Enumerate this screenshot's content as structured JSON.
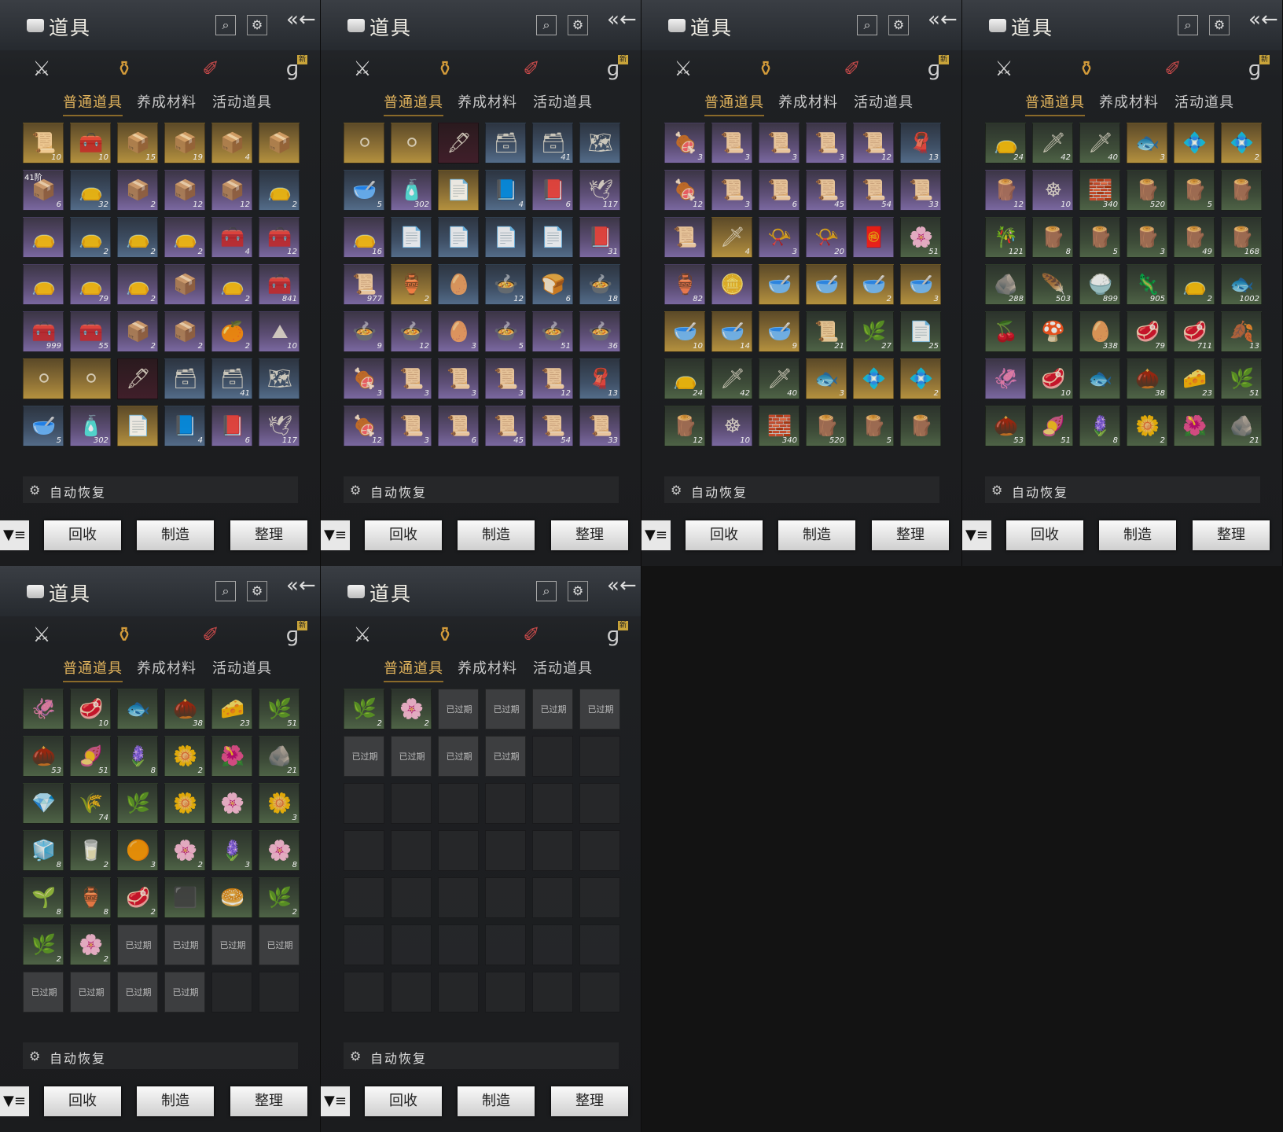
{
  "ui": {
    "title": "道具",
    "categories": [
      {
        "name": "weapon",
        "glyph": "⚔"
      },
      {
        "name": "bag",
        "glyph": "⚱"
      },
      {
        "name": "scroll",
        "glyph": "✐"
      },
      {
        "name": "special",
        "glyph": "ɡ"
      }
    ],
    "new_badge": "新",
    "subtabs": [
      "普通道具",
      "养成材料",
      "活动道具"
    ],
    "auto_recover": "自动恢复",
    "buttons": [
      "回收",
      "制造",
      "整理"
    ],
    "expired_label": "已过期",
    "search_glyph": "⌕",
    "gear_glyph": "⚙",
    "back_glyph": "«←",
    "filter_glyph": "▼≡"
  },
  "colors": {
    "accent_gold": "#e1b35c",
    "rarity_gold": "#b4913e",
    "rarity_purple": "#7a68a0",
    "rarity_blue": "#536c89",
    "rarity_green": "#4e6346"
  },
  "panels": [
    {
      "slots": [
        [
          "g",
          "📜",
          "10"
        ],
        [
          "g",
          "🧰",
          "10"
        ],
        [
          "g",
          "📦",
          "15"
        ],
        [
          "g",
          "📦",
          "19"
        ],
        [
          "g",
          "📦",
          "4"
        ],
        [
          "g",
          "📦",
          ""
        ],
        [
          "p",
          "📦",
          "6",
          "41阶"
        ],
        [
          "b",
          "👝",
          "32"
        ],
        [
          "p",
          "📦",
          "2"
        ],
        [
          "p",
          "📦",
          "12"
        ],
        [
          "p",
          "📦",
          "12"
        ],
        [
          "b",
          "👝",
          "2"
        ],
        [
          "p",
          "👝",
          ""
        ],
        [
          "b",
          "👝",
          "2"
        ],
        [
          "b",
          "👝",
          "2"
        ],
        [
          "p",
          "👝",
          "2"
        ],
        [
          "p",
          "🧰",
          "4"
        ],
        [
          "p",
          "🧰",
          "12"
        ],
        [
          "p",
          "👝",
          ""
        ],
        [
          "p",
          "👝",
          "79"
        ],
        [
          "p",
          "👝",
          "2"
        ],
        [
          "p",
          "📦",
          ""
        ],
        [
          "p",
          "👝",
          "2"
        ],
        [
          "p",
          "🧰",
          "841"
        ],
        [
          "p",
          "🧰",
          "999"
        ],
        [
          "p",
          "🧰",
          "55"
        ],
        [
          "p",
          "📦",
          "2"
        ],
        [
          "p",
          "📦",
          "2"
        ],
        [
          "p",
          "🍊",
          "2"
        ],
        [
          "p",
          "⛰",
          "10"
        ],
        [
          "g",
          "⚪",
          ""
        ],
        [
          "g",
          "⚪",
          ""
        ],
        [
          "r",
          "🖋",
          ""
        ],
        [
          "b",
          "🗃",
          ""
        ],
        [
          "b",
          "🗃",
          "41"
        ],
        [
          "b",
          "🗺",
          ""
        ],
        [
          "b",
          "🥣",
          "5"
        ],
        [
          "p",
          "🧴",
          "302"
        ],
        [
          "g",
          "📄",
          ""
        ],
        [
          "b",
          "📘",
          "4"
        ],
        [
          "p",
          "📕",
          "6"
        ],
        [
          "p",
          "🕊",
          "117"
        ]
      ]
    },
    {
      "slots": [
        [
          "g",
          "⚪",
          ""
        ],
        [
          "g",
          "⚪",
          ""
        ],
        [
          "r",
          "🖋",
          ""
        ],
        [
          "b",
          "🗃",
          ""
        ],
        [
          "b",
          "🗃",
          "41"
        ],
        [
          "b",
          "🗺",
          ""
        ],
        [
          "b",
          "🥣",
          "5"
        ],
        [
          "p",
          "🧴",
          "302"
        ],
        [
          "g",
          "📄",
          ""
        ],
        [
          "b",
          "📘",
          "4"
        ],
        [
          "p",
          "📕",
          "6"
        ],
        [
          "p",
          "🕊",
          "117"
        ],
        [
          "p",
          "👝",
          "16"
        ],
        [
          "b",
          "📄",
          ""
        ],
        [
          "b",
          "📄",
          ""
        ],
        [
          "b",
          "📄",
          ""
        ],
        [
          "b",
          "📄",
          ""
        ],
        [
          "p",
          "📕",
          "31"
        ],
        [
          "p",
          "📜",
          "977"
        ],
        [
          "g",
          "🏺",
          "2"
        ],
        [
          "b",
          "🥚",
          ""
        ],
        [
          "b",
          "🍲",
          "12"
        ],
        [
          "b",
          "🍞",
          "6"
        ],
        [
          "b",
          "🍲",
          "18"
        ],
        [
          "p",
          "🍲",
          "9"
        ],
        [
          "p",
          "🍲",
          "12"
        ],
        [
          "p",
          "🥚",
          "3"
        ],
        [
          "p",
          "🍲",
          "5"
        ],
        [
          "p",
          "🍲",
          "51"
        ],
        [
          "p",
          "🍲",
          "36"
        ],
        [
          "p",
          "🍖",
          "3"
        ],
        [
          "p",
          "📜",
          "3"
        ],
        [
          "p",
          "📜",
          "3"
        ],
        [
          "p",
          "📜",
          "3"
        ],
        [
          "p",
          "📜",
          "12"
        ],
        [
          "b",
          "🧣",
          "13"
        ],
        [
          "p",
          "🍖",
          "12"
        ],
        [
          "p",
          "📜",
          "3"
        ],
        [
          "p",
          "📜",
          "6"
        ],
        [
          "p",
          "📜",
          "45"
        ],
        [
          "p",
          "📜",
          "54"
        ],
        [
          "p",
          "📜",
          "33"
        ]
      ]
    },
    {
      "slots": [
        [
          "p",
          "🍖",
          "3"
        ],
        [
          "p",
          "📜",
          "3"
        ],
        [
          "p",
          "📜",
          "3"
        ],
        [
          "p",
          "📜",
          "3"
        ],
        [
          "p",
          "📜",
          "12"
        ],
        [
          "b",
          "🧣",
          "13"
        ],
        [
          "p",
          "🍖",
          "12"
        ],
        [
          "p",
          "📜",
          "3"
        ],
        [
          "p",
          "📜",
          "6"
        ],
        [
          "p",
          "📜",
          "45"
        ],
        [
          "p",
          "📜",
          "54"
        ],
        [
          "p",
          "📜",
          "33"
        ],
        [
          "p",
          "📜",
          ""
        ],
        [
          "g",
          "🗡",
          "4"
        ],
        [
          "p",
          "📯",
          "3"
        ],
        [
          "p",
          "📯",
          "20"
        ],
        [
          "p",
          "🧧",
          ""
        ],
        [
          "gr",
          "🌸",
          "51"
        ],
        [
          "p",
          "🏺",
          "82"
        ],
        [
          "p",
          "🪙",
          ""
        ],
        [
          "g",
          "🥣",
          ""
        ],
        [
          "g",
          "🥣",
          ""
        ],
        [
          "g",
          "🥣",
          "2"
        ],
        [
          "g",
          "🥣",
          "3"
        ],
        [
          "g",
          "🥣",
          "10"
        ],
        [
          "g",
          "🥣",
          "14"
        ],
        [
          "g",
          "🥣",
          "9"
        ],
        [
          "gr",
          "📜",
          "21"
        ],
        [
          "gr",
          "🌿",
          "27"
        ],
        [
          "gr",
          "📄",
          "25"
        ],
        [
          "gr",
          "👝",
          "24"
        ],
        [
          "gr",
          "🗡",
          "42"
        ],
        [
          "gr",
          "🗡",
          "40"
        ],
        [
          "g",
          "🐟",
          "3"
        ],
        [
          "g",
          "💠",
          ""
        ],
        [
          "g",
          "💠",
          "2"
        ],
        [
          "gr",
          "🪵",
          "12"
        ],
        [
          "p",
          "☸",
          "10"
        ],
        [
          "gr",
          "🧱",
          "340"
        ],
        [
          "gr",
          "🪵",
          "520"
        ],
        [
          "gr",
          "🪵",
          "5"
        ],
        [
          "gr",
          "🪵",
          ""
        ]
      ]
    },
    {
      "slots": [
        [
          "gr",
          "👝",
          "24"
        ],
        [
          "gr",
          "🗡",
          "42"
        ],
        [
          "gr",
          "🗡",
          "40"
        ],
        [
          "g",
          "🐟",
          "3"
        ],
        [
          "g",
          "💠",
          ""
        ],
        [
          "g",
          "💠",
          "2"
        ],
        [
          "p",
          "🪵",
          "12"
        ],
        [
          "p",
          "☸",
          "10"
        ],
        [
          "gr",
          "🧱",
          "340"
        ],
        [
          "gr",
          "🪵",
          "520"
        ],
        [
          "gr",
          "🪵",
          "5"
        ],
        [
          "gr",
          "🪵",
          ""
        ],
        [
          "gr",
          "🎋",
          "121"
        ],
        [
          "gr",
          "🪵",
          "8"
        ],
        [
          "gr",
          "🪵",
          "5"
        ],
        [
          "gr",
          "🪵",
          "3"
        ],
        [
          "gr",
          "🪵",
          "49"
        ],
        [
          "gr",
          "🪵",
          "168"
        ],
        [
          "gr",
          "🪨",
          "288"
        ],
        [
          "gr",
          "🪶",
          "503"
        ],
        [
          "gr",
          "🍚",
          "899"
        ],
        [
          "gr",
          "🦎",
          "905"
        ],
        [
          "gr",
          "👝",
          "2"
        ],
        [
          "gr",
          "🐟",
          "1002"
        ],
        [
          "gr",
          "🍒",
          ""
        ],
        [
          "gr",
          "🍄",
          ""
        ],
        [
          "gr",
          "🥚",
          "338"
        ],
        [
          "gr",
          "🥩",
          "79"
        ],
        [
          "gr",
          "🥩",
          "711"
        ],
        [
          "gr",
          "🍂",
          "13"
        ],
        [
          "p",
          "🦑",
          ""
        ],
        [
          "gr",
          "🥩",
          "10"
        ],
        [
          "gr",
          "🐟",
          ""
        ],
        [
          "gr",
          "🌰",
          "38"
        ],
        [
          "gr",
          "🧀",
          "23"
        ],
        [
          "gr",
          "🌿",
          "51"
        ],
        [
          "gr",
          "🌰",
          "53"
        ],
        [
          "gr",
          "🍠",
          "51"
        ],
        [
          "gr",
          "🪻",
          "8"
        ],
        [
          "gr",
          "🌼",
          "2"
        ],
        [
          "gr",
          "🌺",
          ""
        ],
        [
          "gr",
          "🪨",
          "21"
        ]
      ]
    },
    {
      "slots": [
        [
          "gr",
          "🦑",
          ""
        ],
        [
          "gr",
          "🥩",
          "10"
        ],
        [
          "gr",
          "🐟",
          ""
        ],
        [
          "gr",
          "🌰",
          "38"
        ],
        [
          "gr",
          "🧀",
          "23"
        ],
        [
          "gr",
          "🌿",
          "51"
        ],
        [
          "gr",
          "🌰",
          "53"
        ],
        [
          "gr",
          "🍠",
          "51"
        ],
        [
          "gr",
          "🪻",
          "8"
        ],
        [
          "gr",
          "🌼",
          "2"
        ],
        [
          "gr",
          "🌺",
          ""
        ],
        [
          "gr",
          "🪨",
          "21"
        ],
        [
          "gr",
          "💎",
          ""
        ],
        [
          "gr",
          "🌾",
          "74"
        ],
        [
          "gr",
          "🌿",
          ""
        ],
        [
          "gr",
          "🌼",
          ""
        ],
        [
          "gr",
          "🌸",
          ""
        ],
        [
          "gr",
          "🌼",
          "3"
        ],
        [
          "gr",
          "🧊",
          "8"
        ],
        [
          "gr",
          "🥛",
          "2"
        ],
        [
          "gr",
          "🟠",
          "3"
        ],
        [
          "gr",
          "🌸",
          "2"
        ],
        [
          "gr",
          "🪻",
          "3"
        ],
        [
          "gr",
          "🌸",
          "8"
        ],
        [
          "gr",
          "🌱",
          "8"
        ],
        [
          "gr",
          "🏺",
          "8"
        ],
        [
          "gr",
          "🥩",
          "2"
        ],
        [
          "gr",
          "⬛",
          ""
        ],
        [
          "gr",
          "🥯",
          ""
        ],
        [
          "gr",
          "🌿",
          "2"
        ],
        [
          "gr",
          "🌿",
          "2"
        ],
        [
          "gr",
          "🌸",
          "2"
        ],
        [
          "x"
        ],
        [
          "x"
        ],
        [
          "x"
        ],
        [
          "x"
        ],
        [
          "x"
        ],
        [
          "x"
        ],
        [
          "x"
        ],
        [
          "x"
        ],
        [
          "e"
        ],
        [
          "e"
        ]
      ]
    },
    {
      "slots": [
        [
          "gr",
          "🌿",
          "2"
        ],
        [
          "gr",
          "🌸",
          "2"
        ],
        [
          "x"
        ],
        [
          "x"
        ],
        [
          "x"
        ],
        [
          "x"
        ],
        [
          "x"
        ],
        [
          "x"
        ],
        [
          "x"
        ],
        [
          "x"
        ],
        [
          "e"
        ],
        [
          "e"
        ],
        [
          "e"
        ],
        [
          "e"
        ],
        [
          "e"
        ],
        [
          "e"
        ],
        [
          "e"
        ],
        [
          "e"
        ],
        [
          "e"
        ],
        [
          "e"
        ],
        [
          "e"
        ],
        [
          "e"
        ],
        [
          "e"
        ],
        [
          "e"
        ],
        [
          "e"
        ],
        [
          "e"
        ],
        [
          "e"
        ],
        [
          "e"
        ],
        [
          "e"
        ],
        [
          "e"
        ],
        [
          "e"
        ],
        [
          "e"
        ],
        [
          "e"
        ],
        [
          "e"
        ],
        [
          "e"
        ],
        [
          "e"
        ],
        [
          "e"
        ],
        [
          "e"
        ],
        [
          "e"
        ],
        [
          "e"
        ],
        [
          "e"
        ],
        [
          "e"
        ]
      ]
    }
  ]
}
